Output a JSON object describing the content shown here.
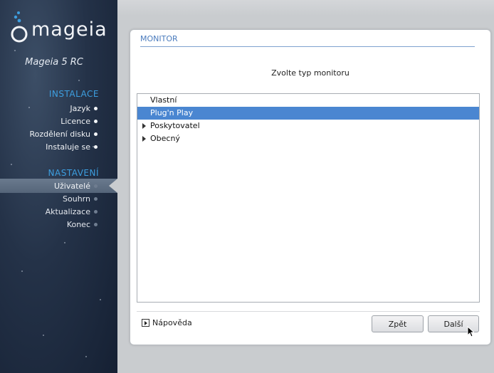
{
  "sidebar": {
    "logo_text": "mageia",
    "version": "Mageia 5 RC",
    "sections": [
      {
        "heading": "INSTALACE",
        "steps": [
          {
            "label": "Jazyk",
            "state": "done"
          },
          {
            "label": "Licence",
            "state": "done"
          },
          {
            "label": "Rozdělení disku",
            "state": "done"
          },
          {
            "label": "Instaluje se",
            "state": "done"
          }
        ]
      },
      {
        "heading": "NASTAVENÍ",
        "steps": [
          {
            "label": "Uživatelé",
            "state": "current"
          },
          {
            "label": "Souhrn",
            "state": "pending"
          },
          {
            "label": "Aktualizace",
            "state": "pending"
          },
          {
            "label": "Konec",
            "state": "pending"
          }
        ]
      }
    ]
  },
  "dialog": {
    "title": "MONITOR",
    "prompt": "Zvolte typ monitoru",
    "tree": [
      {
        "label": "Vlastní",
        "expandable": false,
        "selected": false
      },
      {
        "label": "Plug'n Play",
        "expandable": false,
        "selected": true
      },
      {
        "label": "Poskytovatel",
        "expandable": true,
        "selected": false
      },
      {
        "label": "Obecný",
        "expandable": true,
        "selected": false
      }
    ],
    "help_label": "Nápověda",
    "back_label": "Zpět",
    "next_label": "Další"
  },
  "colors": {
    "accent": "#3d9fe0",
    "selection": "#4a86d1",
    "title": "#4a7bbd"
  }
}
